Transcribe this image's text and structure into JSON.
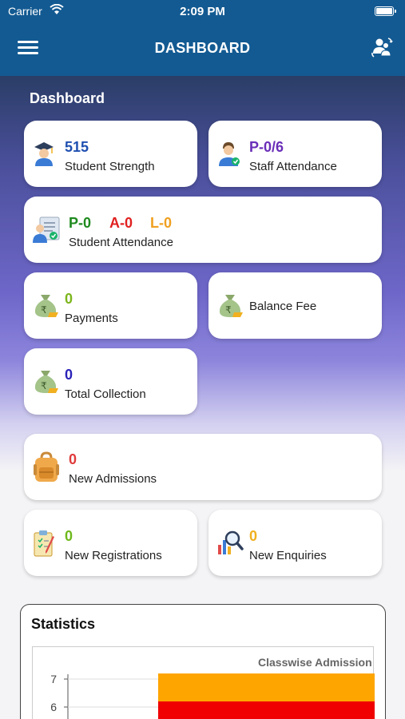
{
  "status_bar": {
    "carrier": "Carrier",
    "time": "2:09 PM"
  },
  "nav": {
    "title": "DASHBOARD"
  },
  "section_title": "Dashboard",
  "cards": {
    "student_strength": {
      "value": "515",
      "label": "Student Strength",
      "color": "#1f4fb0"
    },
    "staff_attendance": {
      "value": "P-0/6",
      "label": "Staff Attendance",
      "color": "#6a2eb8"
    },
    "student_attendance": {
      "present": "P-0",
      "absent": "A-0",
      "leave": "L-0",
      "label": "Student Attendance",
      "colors": {
        "present": "#1e8a1e",
        "absent": "#e02020",
        "leave": "#f0a020"
      }
    },
    "payments": {
      "value": "0",
      "label": "Payments",
      "color": "#7cb51c"
    },
    "balance_fee": {
      "label": "Balance Fee"
    },
    "total_collection": {
      "value": "0",
      "label": "Total Collection",
      "color": "#2a22b8"
    },
    "new_admissions": {
      "value": "0",
      "label": "New Admissions",
      "color": "#e03a3a"
    },
    "new_registrations": {
      "value": "0",
      "label": "New Registrations",
      "color": "#6fb81c"
    },
    "new_enquiries": {
      "value": "0",
      "label": "New Enquiries",
      "color": "#f0b020"
    }
  },
  "statistics": {
    "title": "Statistics",
    "chart_data": {
      "type": "bar",
      "title": "Classwise Admission",
      "y_ticks": [
        "7",
        "6"
      ],
      "ylim_visible": [
        5.5,
        7.2
      ],
      "series": [
        {
          "values": [
            7
          ],
          "color": "#ffa500"
        },
        {
          "values": [
            6
          ],
          "color": "#f00000"
        }
      ]
    }
  }
}
